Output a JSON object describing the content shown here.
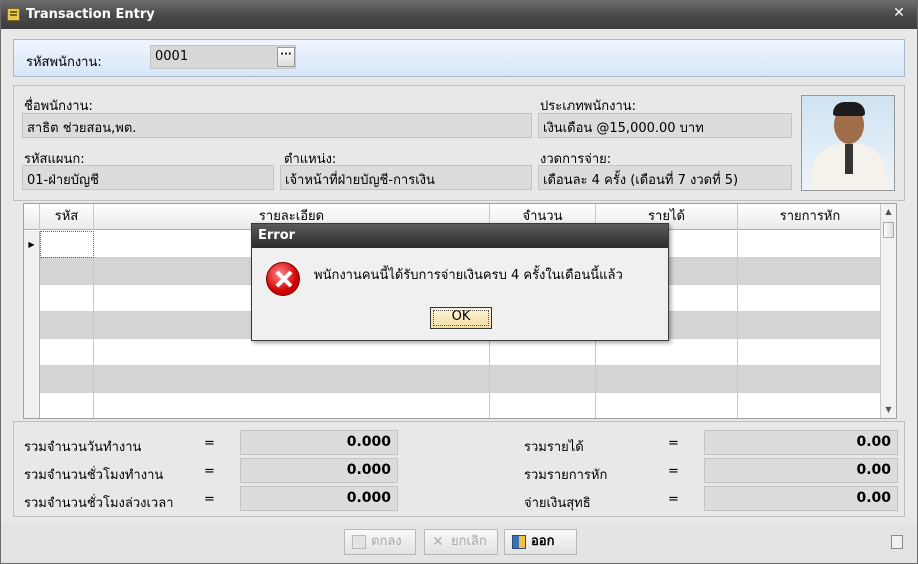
{
  "window": {
    "title": "Transaction Entry",
    "close_glyph": "✕"
  },
  "employee_code": {
    "label": "รหัสพนักงาน:",
    "value": "0001",
    "lookup_glyph": "···"
  },
  "info": {
    "name_label": "ชื่อพนักงาน:",
    "name_value": "สาธิต  ช่วยสอน,พต.",
    "type_label": "ประเภทพนักงาน:",
    "type_value": "เงินเดือน @15,000.00 บาท",
    "dept_label": "รหัสแผนก:",
    "dept_value": "01-ฝ่ายบัญชี",
    "position_label": "ตำแหน่ง:",
    "position_value": "เจ้าหน้าที่ฝ่ายบัญชี-การเงิน",
    "period_label": "งวดการจ่าย:",
    "period_value": "เดือนละ 4 ครั้ง (เดือนที่ 7 งวดที่ 5)"
  },
  "grid": {
    "columns": [
      "รหัส",
      "รายละเอียด",
      "จำนวน",
      "รายได้",
      "รายการหัก"
    ],
    "row_indicator": "▶"
  },
  "totals": {
    "work_days_label": "รวมจำนวนวันทำงาน",
    "work_days_value": "0.000",
    "work_hours_label": "รวมจำนวนชั่วโมงทำงาน",
    "work_hours_value": "0.000",
    "ot_hours_label": "รวมจำนวนชั่วโมงล่วงเวลา",
    "ot_hours_value": "0.000",
    "income_label": "รวมรายได้",
    "income_value": "0.00",
    "deduction_label": "รวมรายการหัก",
    "deduction_value": "0.00",
    "net_label": "จ่ายเงินสุทธิ",
    "net_value": "0.00",
    "equals": "="
  },
  "buttons": {
    "ok": "ตกลง",
    "cancel": "ยกเลิก",
    "exit": "ออก"
  },
  "dialog": {
    "title": "Error",
    "message": "พนักงานคนนี้ได้รับการจ่ายเงินครบ 4 ครั้งในเดือนนี้แล้ว",
    "ok_label": "OK"
  },
  "colors": {
    "error_red": "#d40000",
    "title_bar": "#4a4a4a",
    "alt_row": "#d4d4d4"
  }
}
